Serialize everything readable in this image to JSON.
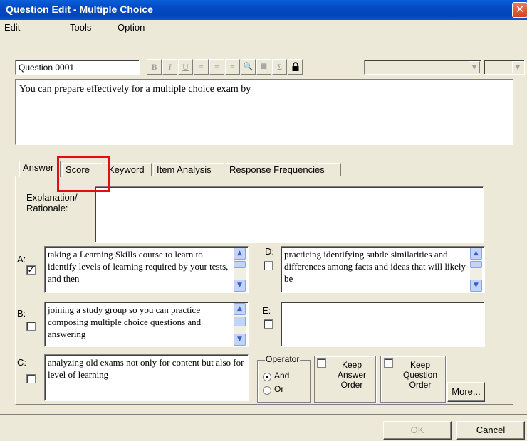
{
  "window": {
    "title": "Question Edit - Multiple Choice",
    "close_glyph": "✕"
  },
  "menu": [
    "Edit",
    "Tools",
    "Option"
  ],
  "toolbar": {
    "question_name": "Question 0001",
    "buttons": [
      {
        "name": "bold-icon",
        "glyph": "B"
      },
      {
        "name": "italic-icon",
        "glyph": "I"
      },
      {
        "name": "underline-icon",
        "glyph": "U"
      },
      {
        "name": "align-left-icon",
        "glyph": "≡"
      },
      {
        "name": "align-center-icon",
        "glyph": "≡"
      },
      {
        "name": "align-right-icon",
        "glyph": "≡"
      },
      {
        "name": "zoom-icon",
        "glyph": "🔍"
      },
      {
        "name": "color-icon",
        "glyph": "■"
      },
      {
        "name": "sigma-icon",
        "glyph": "Σ"
      },
      {
        "name": "lock-icon",
        "glyph": "🔒"
      }
    ],
    "font_combo_value": "",
    "size_combo_value": "",
    "dropdown_glyph": "▼"
  },
  "question_text": "You can prepare effectively for a multiple choice exam by",
  "tabs": [
    "Answer",
    "Score",
    "Keyword",
    "Item Analysis",
    "Response Frequencies"
  ],
  "explanation_label": "Explanation/ Rationale:",
  "explanation_value": "",
  "answers": {
    "A": {
      "label": "A:",
      "checked": true,
      "text": "taking a Learning Skills course to learn to identify levels of learning required by your tests, and then"
    },
    "B": {
      "label": "B:",
      "checked": false,
      "text": "joining a study group so you can practice composing multiple choice questions and answering"
    },
    "C": {
      "label": "C:",
      "checked": false,
      "text": "analyzing old exams not only for content but also for level of learning"
    },
    "D": {
      "label": "D:",
      "checked": false,
      "text": "practicing identifying subtle similarities and differences among facts and ideas that will likely be"
    },
    "E": {
      "label": "E:",
      "checked": false,
      "text": ""
    }
  },
  "check_glyph": "✓",
  "scroll_up": "▲",
  "scroll_down": "▼",
  "operator": {
    "legend": "Operator",
    "options": [
      "And",
      "Or"
    ],
    "selected": "And"
  },
  "keep_answer_order": {
    "label": "Keep Answer Order",
    "checked": false
  },
  "keep_question_order": {
    "label": "Keep Question Order",
    "checked": false
  },
  "buttons": {
    "more": "More...",
    "ok": "OK",
    "cancel": "Cancel"
  }
}
